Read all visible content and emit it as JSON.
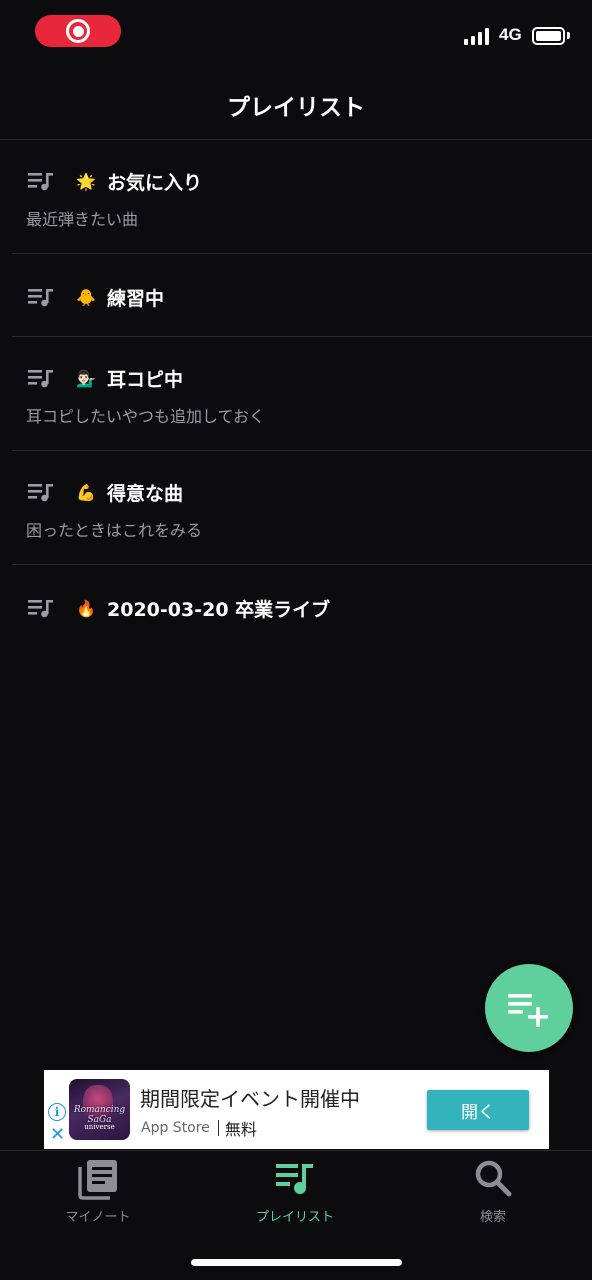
{
  "status_bar": {
    "network": "4G",
    "signal_bars": 4,
    "battery_level": 1.0
  },
  "header": {
    "title": "プレイリスト"
  },
  "playlists": [
    {
      "emoji": "🌟",
      "title": "お気に入り",
      "subtitle": "最近弾きたい曲"
    },
    {
      "emoji": "🐥",
      "title": "練習中",
      "subtitle": ""
    },
    {
      "emoji": "💁🏻‍♂️",
      "title": "耳コピ中",
      "subtitle": "耳コピしたいやつも追加しておく"
    },
    {
      "emoji": "💪",
      "title": "得意な曲",
      "subtitle": "困ったときはこれをみる"
    },
    {
      "emoji": "🔥",
      "title": "2020-03-20 卒業ライブ",
      "subtitle": ""
    }
  ],
  "fab": {
    "icon": "playlist-add-icon"
  },
  "ad": {
    "title": "期間限定イベント開催中",
    "store": "App Store",
    "price": "無料",
    "open_label": "開く",
    "thumb_text": "Romancing SaGa",
    "thumb_subtext": "universe"
  },
  "tabs": [
    {
      "label": "マイノート",
      "icon": "notes-icon",
      "active": false
    },
    {
      "label": "プレイリスト",
      "icon": "playlist-icon",
      "active": true
    },
    {
      "label": "検索",
      "icon": "search-icon",
      "active": false
    }
  ],
  "colors": {
    "background": "#0c0b0d",
    "accent": "#5fcf9c",
    "record": "#e8283a",
    "ad_button": "#35b3bd",
    "subtitle": "#9b9a9e"
  }
}
